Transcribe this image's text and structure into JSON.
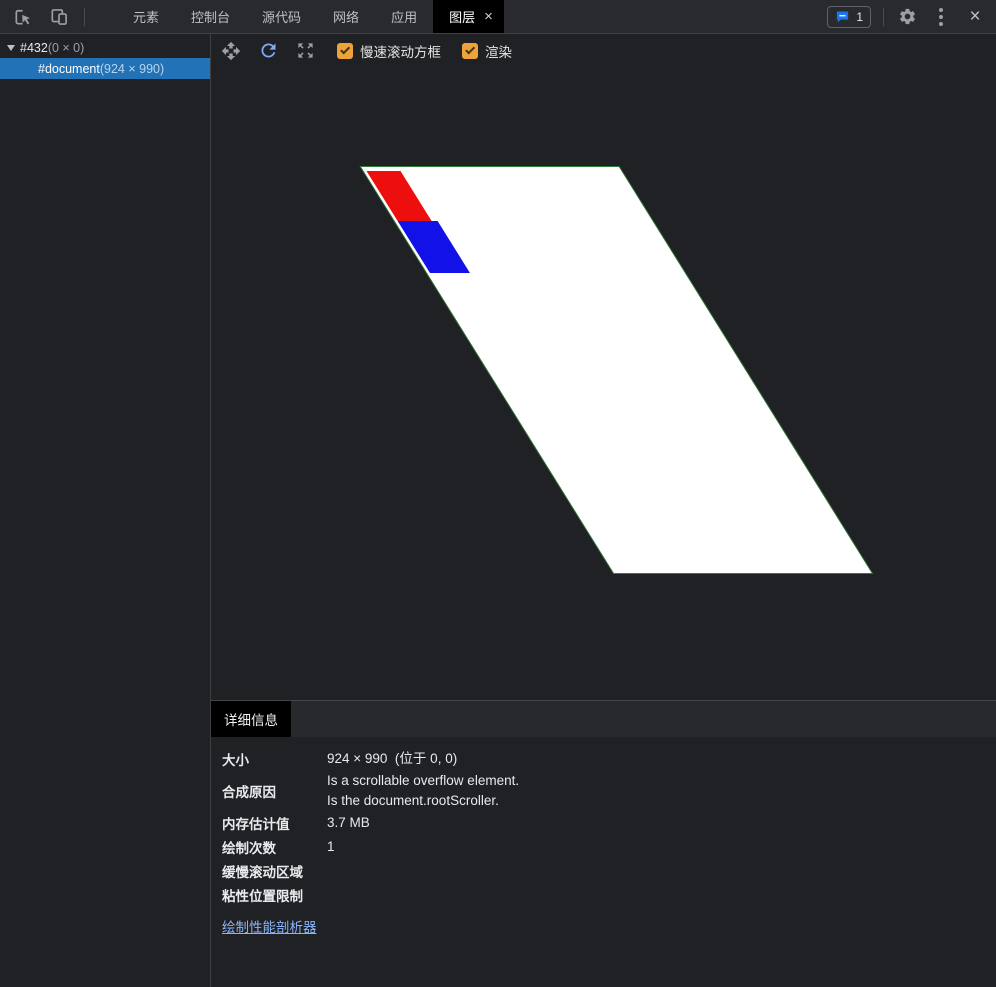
{
  "header": {
    "tabs": [
      {
        "label": "元素"
      },
      {
        "label": "控制台"
      },
      {
        "label": "源代码"
      },
      {
        "label": "网络"
      },
      {
        "label": "应用"
      },
      {
        "label": "图层",
        "active": true,
        "close_glyph": "×"
      }
    ],
    "issues_count": "1",
    "close_glyph": "×"
  },
  "layers_panel": {
    "toolbar": {
      "checkbox_slow_scroll_label": "慢速滚动方框",
      "checkbox_paints_label": "渲染",
      "slow_scroll_checked": true,
      "paints_checked": true
    },
    "tree": {
      "root_name": "#432",
      "root_dims": "(0 × 0)",
      "document_name": "#document",
      "document_dims": "(924 × 990)"
    },
    "canvas": {
      "layer_width": 924,
      "layer_height": 990,
      "layer_fill": "#ffffff",
      "layer_border": "#2f7d36",
      "scroll_rect_red": "#ed0e0e",
      "scroll_rect_blue": "#1212e8"
    }
  },
  "details": {
    "tab_label": "详细信息",
    "rows": [
      {
        "label": "大小",
        "value": "924 × 990  (位于 0, 0)"
      },
      {
        "label": "合成原因",
        "values": [
          "Is a scrollable overflow element.",
          "Is the document.rootScroller."
        ]
      },
      {
        "label": "内存估计值",
        "value": "3.7 MB"
      },
      {
        "label": "绘制次数",
        "value": "1"
      },
      {
        "label": "缓慢滚动区域",
        "value": ""
      },
      {
        "label": "粘性位置限制",
        "value": ""
      }
    ],
    "link_label": "绘制性能剖析器"
  },
  "colors": {
    "background": "#202124",
    "toolbar_background": "#292a2d",
    "active_tab_background": "#000000",
    "selection_blue": "#2272b8",
    "checkbox_accent": "#eda23b",
    "link_blue": "#8ab4f8",
    "issues_icon_blue": "#1a73e8",
    "rotate_icon_blue": "#7cacf8"
  }
}
